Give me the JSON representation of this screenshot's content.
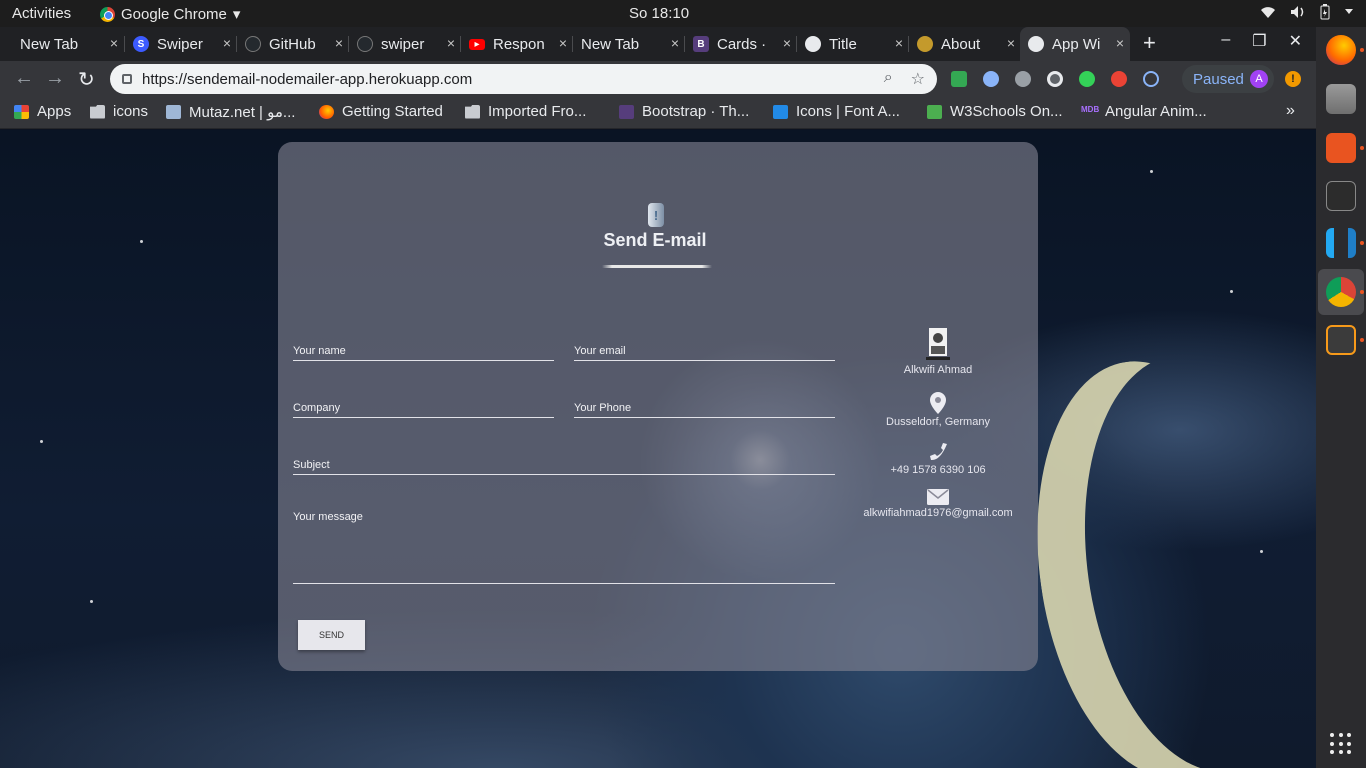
{
  "topbar": {
    "activities": "Activities",
    "app_name": "Google Chrome",
    "app_menu_arrow": "▾",
    "clock": "So 18:10"
  },
  "tabs": [
    {
      "title": "New Tab",
      "favicon": "none"
    },
    {
      "title": "Swiper",
      "favicon": "swiper-icon",
      "color": "#3c5bff"
    },
    {
      "title": "GitHub",
      "favicon": "github-icon",
      "color": "#333333"
    },
    {
      "title": "swiper",
      "favicon": "github-icon",
      "color": "#333333"
    },
    {
      "title": "Respon",
      "favicon": "youtube-icon",
      "color": "#ff0000"
    },
    {
      "title": "New Tab",
      "favicon": "none"
    },
    {
      "title": "Cards ·",
      "favicon": "bootstrap-icon",
      "color": "#563d7c"
    },
    {
      "title": "Title",
      "favicon": "globe-icon",
      "color": "#e8eaed"
    },
    {
      "title": "About",
      "favicon": "about-icon",
      "color": "#c49a2c"
    },
    {
      "title": "App Wi",
      "favicon": "globe-icon",
      "color": "#e8eaed",
      "active": true
    }
  ],
  "tab_close_glyph": "×",
  "new_tab_glyph": "+",
  "window_controls": {
    "minimize": "–",
    "maximize": "❐",
    "close": "✕"
  },
  "toolbar": {
    "back": "←",
    "forward": "→",
    "reload": "↻",
    "url": "https://sendemail-nodemailer-app.herokuapp.com",
    "zoom_glyph": "⌕",
    "star_glyph": "☆",
    "profile_status": "Paused",
    "profile_initial": "A",
    "alert_glyph": "!"
  },
  "bookmarks": [
    {
      "label": "Apps",
      "icon": "apps-grid-icon"
    },
    {
      "label": "icons",
      "icon": "folder-icon"
    },
    {
      "label": "Mutaz.net | مو...",
      "icon": "mutaz-icon"
    },
    {
      "label": "Getting Started",
      "icon": "firefox-icon"
    },
    {
      "label": "Imported Fro...",
      "icon": "folder-icon"
    },
    {
      "label": "Bootstrap · Th...",
      "icon": "bootstrap-icon"
    },
    {
      "label": "Icons | Font A...",
      "icon": "fontawesome-icon"
    },
    {
      "label": "W3Schools On...",
      "icon": "w3schools-icon"
    },
    {
      "label": "Angular Anim...",
      "icon": "mdb-icon"
    }
  ],
  "bookmarks_more": "»",
  "form": {
    "title": "Send E-mail",
    "logo_glyph": "!",
    "name_placeholder": "Your name",
    "email_placeholder": "Your email",
    "company_placeholder": "Company",
    "phone_placeholder": "Your Phone",
    "subject_placeholder": "Subject",
    "message_placeholder": "Your message",
    "send_label": "SEND"
  },
  "contact": {
    "name": "Alkwifi Ahmad",
    "location": "Dusseldorf, Germany",
    "phone": "+49 1578 6390 106",
    "email": "alkwifiahmad1976@gmail.com"
  },
  "dock": [
    "firefox-icon",
    "files-icon",
    "software-center-icon",
    "terminal-icon",
    "vscode-icon",
    "chrome-icon",
    "sublime-text-icon"
  ]
}
